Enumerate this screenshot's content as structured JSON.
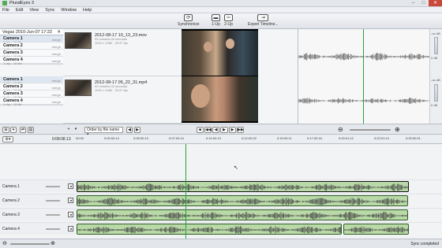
{
  "window": {
    "title": "PluralEyes 3"
  },
  "menu": [
    "File",
    "Edit",
    "View",
    "Sync",
    "Window",
    "Help"
  ],
  "toolbar": {
    "synchronize": "Synchronize",
    "one_up": "1-Up",
    "two_up": "2-Up",
    "export": "Export Timeline..."
  },
  "project_tab": "Vegas 2010-Jun-07 17:22",
  "groups": [
    {
      "rows": [
        {
          "name": "Camera 1",
          "sub": "1 clip · 19 file",
          "merge": "merge"
        },
        {
          "name": "Camera 2",
          "sub": "1 clip · 19 file",
          "merge": "merge"
        },
        {
          "name": "Camera 3",
          "sub": "1 clip · 19 file",
          "merge": "merge"
        },
        {
          "name": "Camera 4",
          "sub": "1 clip · 19 file",
          "merge": "merge"
        }
      ]
    },
    {
      "rows": [
        {
          "name": "Camera 1",
          "sub": "1 clip · 19 file",
          "merge": "merge"
        },
        {
          "name": "Camera 2",
          "sub": "1 clip · 19 file",
          "merge": "merge"
        },
        {
          "name": "Camera 3",
          "sub": "1 clip · 19 file",
          "merge": "merge"
        },
        {
          "name": "Camera 4",
          "sub": "1 clip · 19 file",
          "merge": "merge"
        }
      ]
    }
  ],
  "clips": [
    {
      "name": "2012-08-17 10_13_23.mov",
      "meta1": "00 minutes 02 seconds",
      "meta2": "1920 x 1080 · 29.97 fps"
    },
    {
      "name": "2012-08-17 05_22_31.mp4",
      "meta1": "00 minutes 02 seconds",
      "meta2": "1920 x 1080 · 29.97 fps"
    }
  ],
  "vu_labels": [
    "-oo dB",
    "0 dB",
    "-oo dB",
    "0 dB"
  ],
  "controls": {
    "order_label": "Order by file name",
    "timecode": "0:08:08.13"
  },
  "ruler": [
    "00:00",
    "0:00:00:14",
    "0:05:00:13",
    "0:07:00:14",
    "0:10:00:13",
    "0:12:00:22",
    "0:15:00:11",
    "0:17:00:16",
    "0:20:01:12",
    "0:22:01:14",
    "0:25:00:01"
  ],
  "tracks": [
    {
      "name": "Camera 1"
    },
    {
      "name": "Camera 2"
    },
    {
      "name": "Camera 3"
    },
    {
      "name": "Camera 4"
    }
  ],
  "status": "Sync completed",
  "colors": {
    "accent": "#1fa53a",
    "clip": "#b9d9a8",
    "waveform": "#3d3d3d"
  }
}
